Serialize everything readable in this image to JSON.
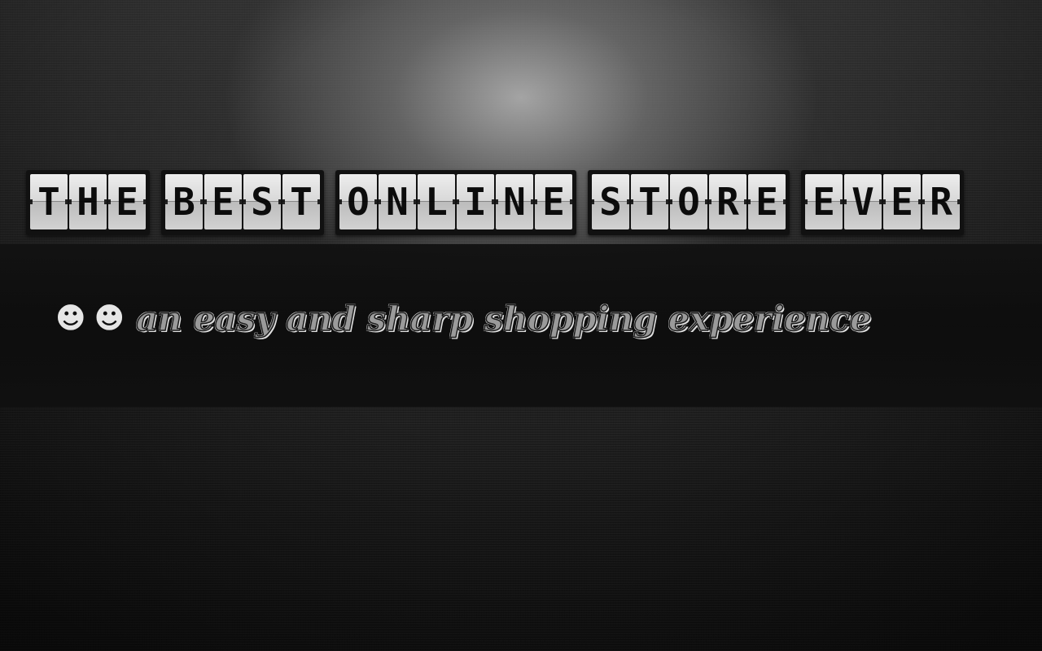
{
  "hero": {
    "title_words": [
      [
        "T",
        "H",
        "E"
      ],
      [
        "B",
        "E",
        "S",
        "T"
      ],
      [
        "O",
        "N",
        "L",
        "I",
        "N",
        "E"
      ],
      [
        "S",
        "T",
        "O",
        "R",
        "E"
      ],
      [
        "E",
        "V",
        "E",
        "R"
      ]
    ],
    "title_text": "THE BEST ONLINE STORE EVER",
    "tagline": {
      "emoji_1": "☻",
      "emoji_2": "☻",
      "text": "an easy and sharp shopping experience"
    }
  },
  "colors": {
    "background_dark": "#1c1c1c",
    "band": "#0f0f0f",
    "tile_face": "#e2e2e2",
    "tile_letter": "#0c0c0c",
    "tagline_fill": "#9a9a9a"
  }
}
